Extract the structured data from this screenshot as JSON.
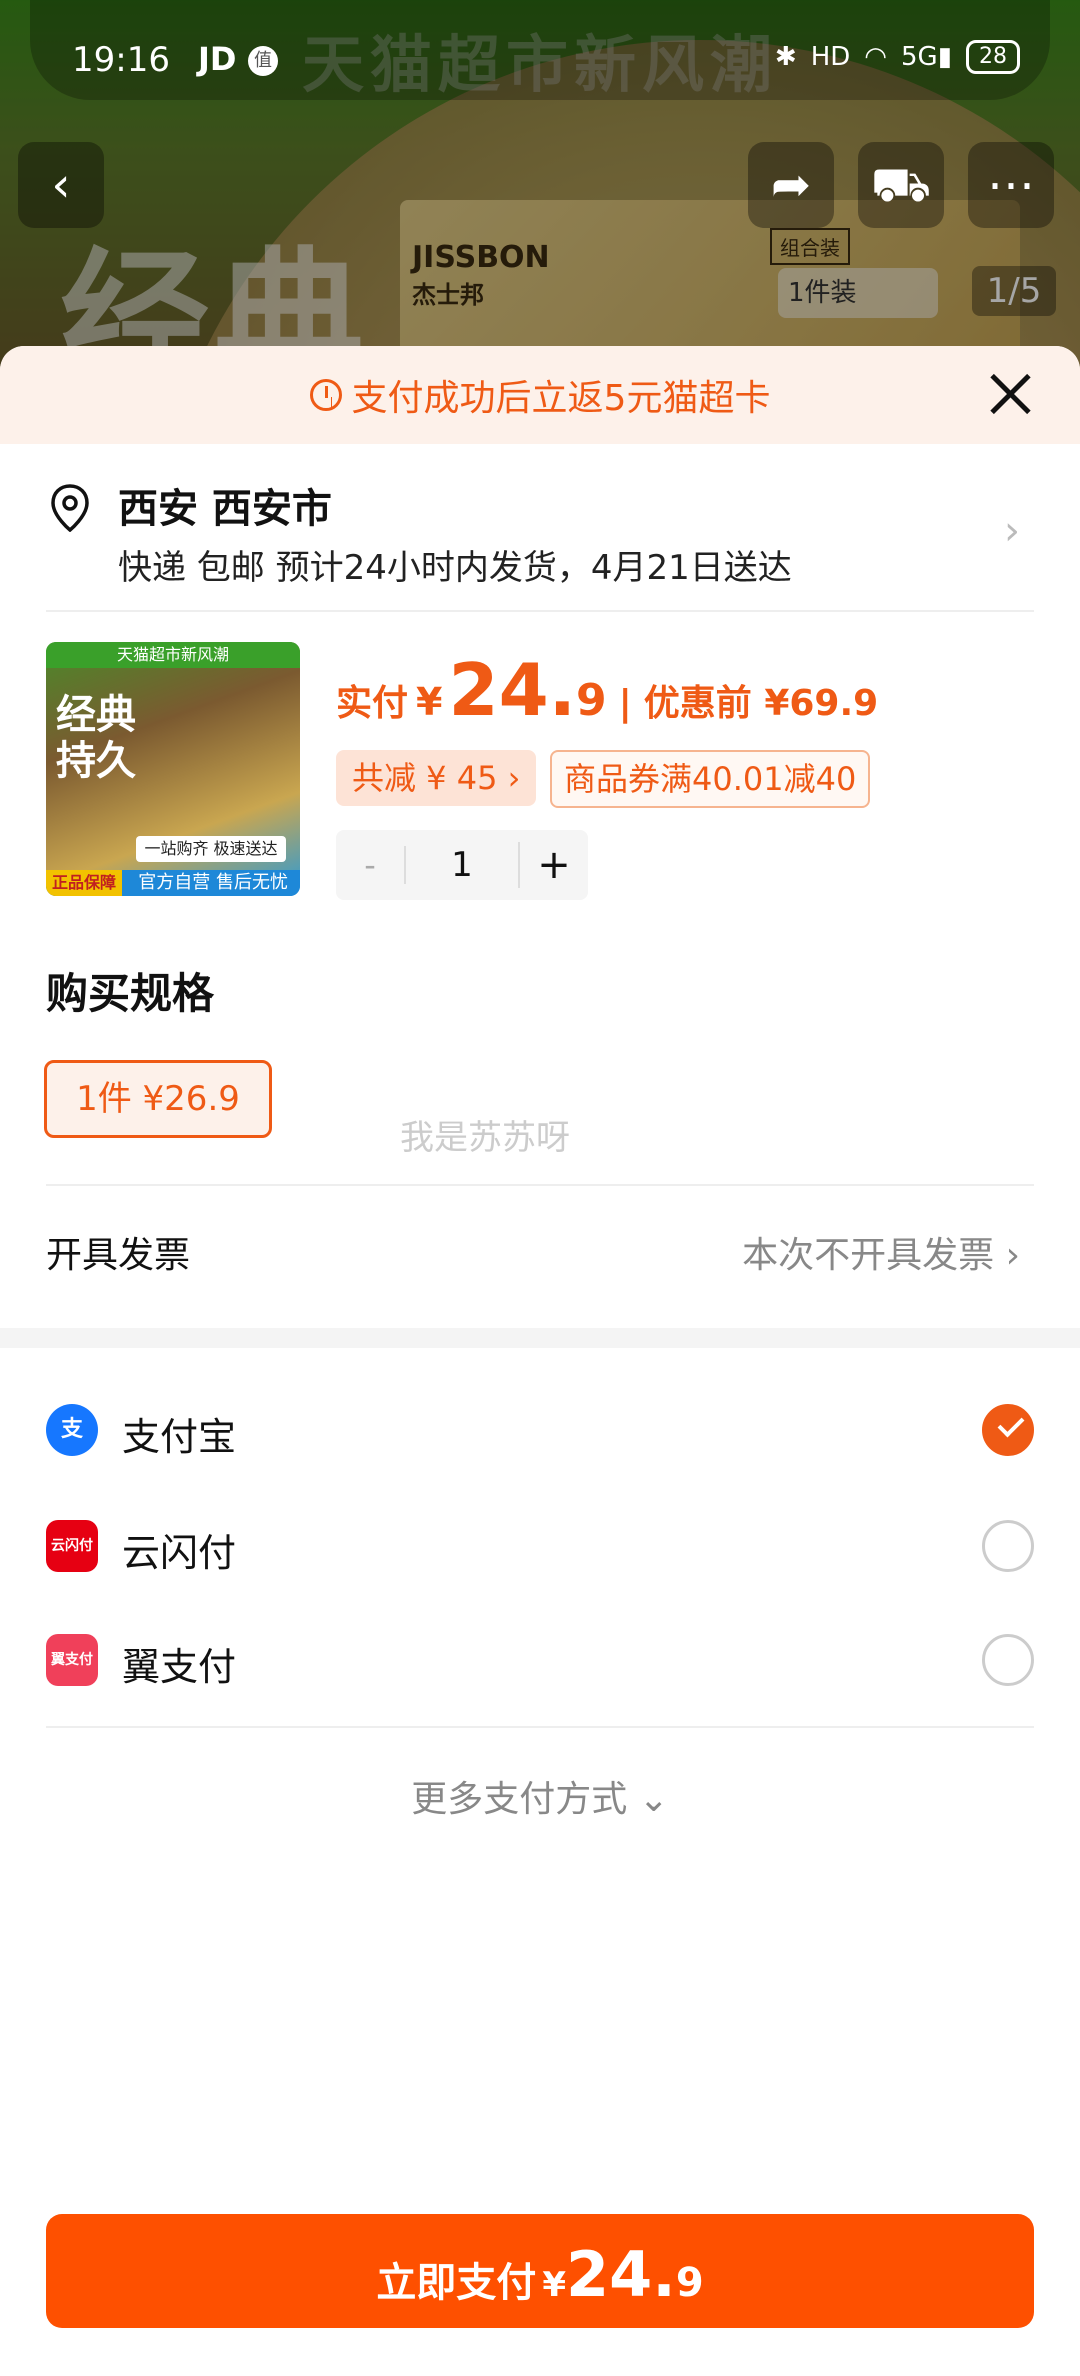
{
  "status_bar": {
    "time": "19:16",
    "app1": "JD",
    "app2": "值",
    "battery": "28",
    "network": "5G",
    "hd": "HD"
  },
  "background": {
    "header_title": "天猫超市新风潮",
    "big_text": "经典",
    "brand": "JISSBON",
    "brand_cn": "杰士邦",
    "tag": "组合装",
    "variant_pill": "1件装",
    "image_counter": "1/5",
    "back_icon": "chevron-left-icon",
    "share_icon": "share-icon",
    "cart_icon": "cart-icon",
    "more_icon": "more-icon"
  },
  "banner": {
    "text": "支付成功后立返5元猫超卡"
  },
  "address": {
    "name": "西安 西安市",
    "detail": "快递 包邮 预计24小时内发货，4月21日送达"
  },
  "product": {
    "thumb_top": "天猫超市新风潮",
    "thumb_title": "经典\n持久",
    "thumb_badge": "正品保障",
    "thumb_footer": "官方自营 售后无忧",
    "thumb_banner": "一站购齐 极速送达",
    "paid_label": "实付",
    "yen": "¥",
    "price_int": "24.",
    "price_dec": "9",
    "sep": "|",
    "pre_price": "优惠前 ¥69.9",
    "tag_discount": "共减 ¥ 45 ›",
    "tag_coupon": "商品券满40.01减40",
    "qty_minus": "-",
    "qty": "1",
    "qty_plus": "+"
  },
  "spec": {
    "title": "购买规格",
    "option": "1件  ¥26.9"
  },
  "watermark": "我是苏苏呀",
  "invoice": {
    "label": "开具发票",
    "value": "本次不开具发票  ›"
  },
  "payments": [
    {
      "name": "支付宝",
      "logo": "支",
      "color": "#1677ff",
      "selected": true
    },
    {
      "name": "云闪付",
      "logo": "云闪付",
      "color": "#e60012",
      "selected": false
    },
    {
      "name": "翼支付",
      "logo": "翼支付",
      "color": "#f0405a",
      "selected": false
    }
  ],
  "more_payments": "更多支付方式 ⌄",
  "pay_button": {
    "text": "立即支付",
    "yen": "¥",
    "int": "24.",
    "dec": "9"
  },
  "colors": {
    "accent": "#ef5a15",
    "button": "#fe5000"
  }
}
